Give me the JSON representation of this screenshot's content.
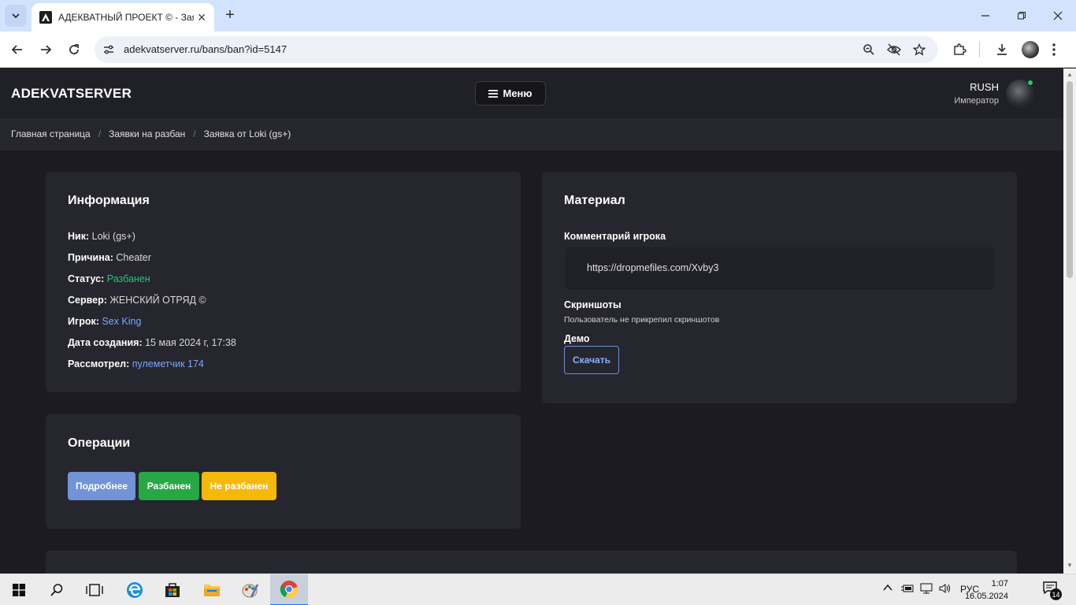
{
  "browser": {
    "tab_title": "АДЕКВАТНЫЙ ПРОЕКТ © - Заявка от Loki (gs+)",
    "url": "adekvatserver.ru/bans/ban?id=5147"
  },
  "header": {
    "brand": "ADEKVATSERVER",
    "menu_label": "Меню",
    "user_name": "RUSH",
    "user_role": "Император"
  },
  "breadcrumb": {
    "items": [
      "Главная страница",
      "Заявки на разбан",
      "Заявка от Loki (gs+)"
    ],
    "separator": "/"
  },
  "info": {
    "title": "Информация",
    "rows": [
      {
        "label": "Ник:",
        "value": "Loki (gs+)"
      },
      {
        "label": "Причина:",
        "value": "Cheater"
      },
      {
        "label": "Статус:",
        "value": "Разбанен"
      },
      {
        "label": "Сервер:",
        "value": "ЖЕНСКИЙ ОТРЯД ©"
      },
      {
        "label": "Игрок:",
        "value": "Sex King"
      },
      {
        "label": "Дата создания:",
        "value": "15 мая 2024 г, 17:38"
      },
      {
        "label": "Рассмотрел:",
        "value": "пулеметчик 174"
      }
    ]
  },
  "material": {
    "title": "Материал",
    "comment_label": "Комментарий игрока",
    "comment_text": "https://dropmefiles.com/Xvby3",
    "screenshots_label": "Скриншоты",
    "screenshots_note": "Пользователь не прикрепил скриншотов",
    "demo_label": "Демо",
    "download_label": "Скачать"
  },
  "operations": {
    "title": "Операции",
    "buttons": [
      {
        "label": "Подробнее",
        "color": "#7293d6"
      },
      {
        "label": "Разбанен",
        "color": "#28a745"
      },
      {
        "label": "Не разбанен",
        "color": "#f5b80c"
      }
    ]
  },
  "taskbar": {
    "lang": "РУС",
    "time": "1:07",
    "date": "16.05.2024",
    "notifications": "14"
  },
  "colors": {
    "page_bg": "#1b1b21",
    "card_bg": "#26262e",
    "status_green": "#28c76f",
    "link_blue": "#7aa7ff"
  }
}
